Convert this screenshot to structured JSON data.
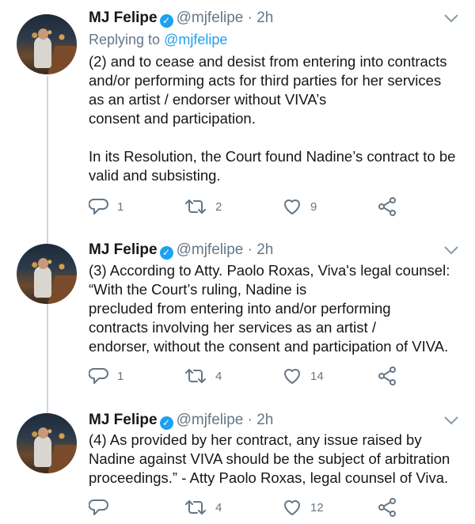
{
  "tweets": [
    {
      "name": "MJ Felipe",
      "handle": "@mjfelipe",
      "time": "2h",
      "reply_prefix": "Replying to",
      "reply_to": "@mjfelipe",
      "lines": [
        "(2) and to cease and desist from entering into contracts",
        "and/or performing acts for third parties for her services",
        "as an artist / endorser without VIVA’s",
        "consent and participation.",
        "",
        "In its Resolution, the Court found Nadine’s contract to be",
        "valid and subsisting."
      ],
      "replies": "1",
      "retweets": "2",
      "likes": "9"
    },
    {
      "name": "MJ Felipe",
      "handle": "@mjfelipe",
      "time": "2h",
      "lines": [
        "(3) According to Atty. Paolo Roxas, Viva's legal counsel:",
        "“With the Court’s ruling, Nadine is",
        "precluded from entering into and/or performing",
        "contracts involving her services as an artist /",
        "endorser, without the consent and participation of VIVA."
      ],
      "replies": "1",
      "retweets": "4",
      "likes": "14"
    },
    {
      "name": "MJ Felipe",
      "handle": "@mjfelipe",
      "time": "2h",
      "lines": [
        "(4) As provided by her contract, any issue raised by",
        "Nadine against VIVA should be the subject of arbitration",
        "proceedings.” - Atty Paolo Roxas, legal counsel of Viva."
      ],
      "replies": "",
      "retweets": "4",
      "likes": "12"
    }
  ],
  "icons": {
    "verified": "verified-badge-icon",
    "caret": "chevron-down-icon",
    "reply": "reply-icon",
    "retweet": "retweet-icon",
    "like": "heart-icon",
    "share": "share-icon"
  },
  "colors": {
    "link": "#1da1f2",
    "muted": "#657786",
    "text": "#14171a",
    "thread_line": "#ccd6dd"
  }
}
